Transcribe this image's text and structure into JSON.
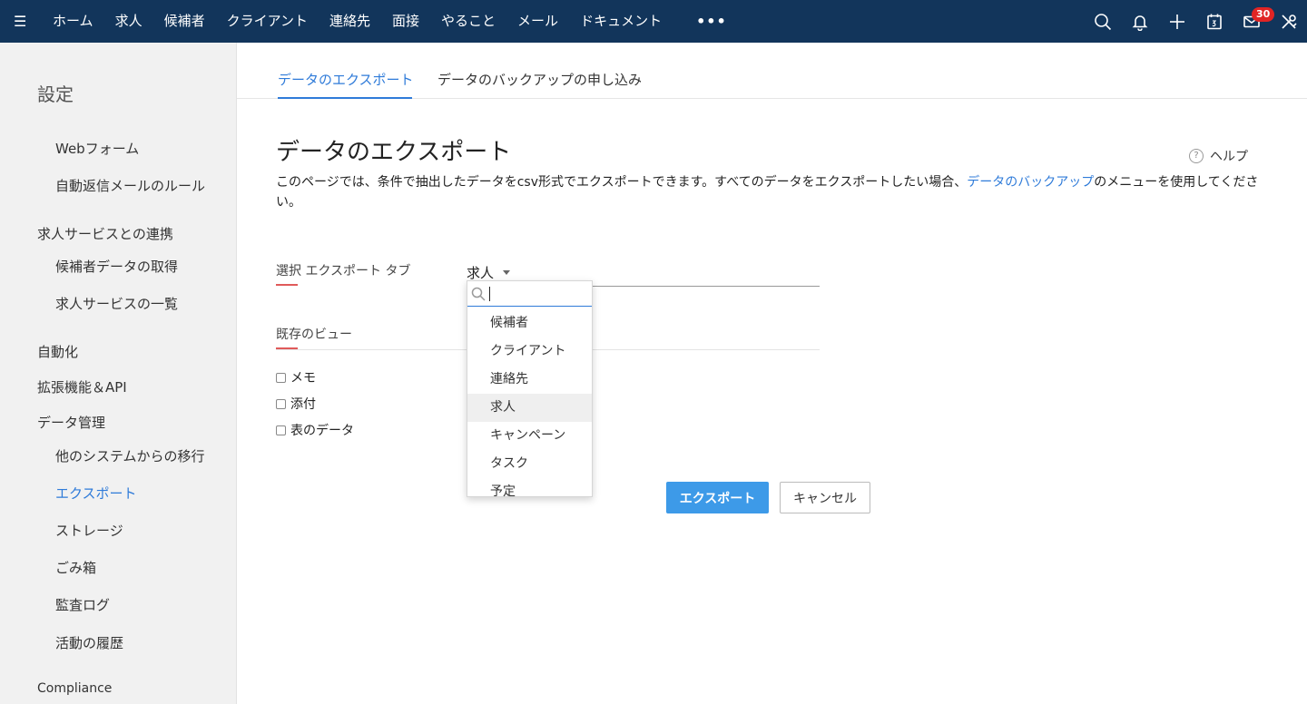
{
  "topbar": {
    "menu_items": [
      "ホーム",
      "求人",
      "候補者",
      "クライアント",
      "連絡先",
      "面接",
      "やること",
      "メール",
      "ドキュメント"
    ],
    "more_label": "•••",
    "mail_badge": "30"
  },
  "sidebar": {
    "title": "設定",
    "items": [
      {
        "label": "Webフォーム",
        "type": "sub"
      },
      {
        "label": "自動返信メールのルール",
        "type": "sub"
      },
      {
        "label": "求人サービスとの連携",
        "type": "section"
      },
      {
        "label": "候補者データの取得",
        "type": "sub"
      },
      {
        "label": "求人サービスの一覧",
        "type": "sub"
      },
      {
        "label": "自動化",
        "type": "section"
      },
      {
        "label": "拡張機能＆API",
        "type": "section"
      },
      {
        "label": "データ管理",
        "type": "section"
      },
      {
        "label": "他のシステムからの移行",
        "type": "sub"
      },
      {
        "label": "エクスポート",
        "type": "sub",
        "active": true
      },
      {
        "label": "ストレージ",
        "type": "sub"
      },
      {
        "label": "ごみ箱",
        "type": "sub"
      },
      {
        "label": "監査ログ",
        "type": "sub"
      },
      {
        "label": "活動の履歴",
        "type": "sub"
      },
      {
        "label": "Compliance",
        "type": "section"
      }
    ]
  },
  "tabs": [
    {
      "label": "データのエクスポート",
      "active": true
    },
    {
      "label": "データのバックアップの申し込み",
      "active": false
    }
  ],
  "main": {
    "title": "データのエクスポート",
    "help_label": "ヘルプ",
    "desc_before": "このページでは、条件で抽出したデータをcsv形式でエクスポートできます。すべてのデータをエクスポートしたい場合、",
    "desc_link": "データのバックアップ",
    "desc_after": "のメニューを使用してください。",
    "export_tab_label": "選択 エクスポート タブ",
    "export_tab_value": "求人",
    "existing_view_label": "既存のビュー",
    "checkboxes": [
      "メモ",
      "添付",
      "表のデータ"
    ],
    "export_button": "エクスポート",
    "cancel_button": "キャンセル"
  },
  "dropdown": {
    "search_value": "",
    "options": [
      "候補者",
      "クライアント",
      "連絡先",
      "求人",
      "キャンペーン",
      "タスク",
      "予定"
    ],
    "highlighted": "求人"
  },
  "colors": {
    "topbar": "#12355b",
    "accent": "#2f7bd9",
    "primary_button": "#3d9ae8",
    "badge": "#e02424"
  }
}
